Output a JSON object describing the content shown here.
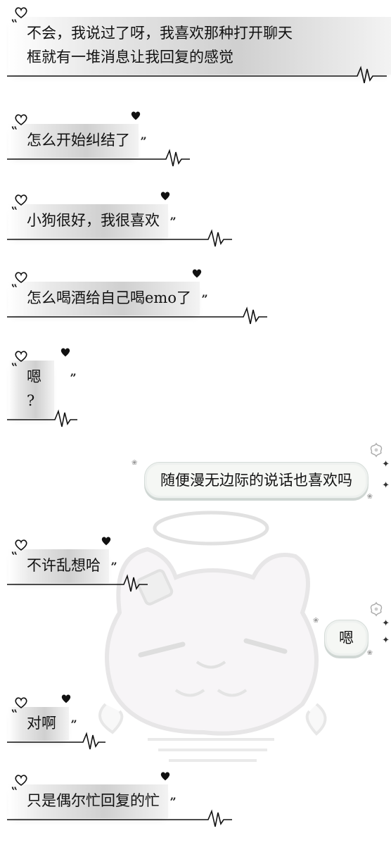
{
  "messages": [
    {
      "side": "left",
      "text": "不会，我说过了呀，我喜欢那种打开聊天\n框就有一堆消息让我回复的感觉"
    },
    {
      "side": "left",
      "text": "怎么开始纠结了"
    },
    {
      "side": "left",
      "text": "小狗很好，我很喜欢"
    },
    {
      "side": "left",
      "text": "怎么喝酒给自己喝emo了"
    },
    {
      "side": "left",
      "text": "嗯\n?"
    },
    {
      "side": "right",
      "text": "随便漫无边际的说话也喜欢吗"
    },
    {
      "side": "left",
      "text": "不许乱想哈"
    },
    {
      "side": "right",
      "text": "嗯"
    },
    {
      "side": "left",
      "text": "对啊"
    },
    {
      "side": "left",
      "text": "只是偶尔忙回复的忙"
    }
  ],
  "icons": {
    "heart": "heart-icon",
    "quote": "quote-mark-icon",
    "pulse": "heartbeat-line-icon",
    "flower": "flower-icon",
    "star": "star-icon",
    "paw": "paw-icon",
    "watermark": "cat-angel-watermark"
  },
  "colors": {
    "text": "#111111",
    "bubble_left": "#d4d4d4",
    "bubble_right": "#f5f7f4",
    "bubble_right_border": "#d5dcd8"
  }
}
